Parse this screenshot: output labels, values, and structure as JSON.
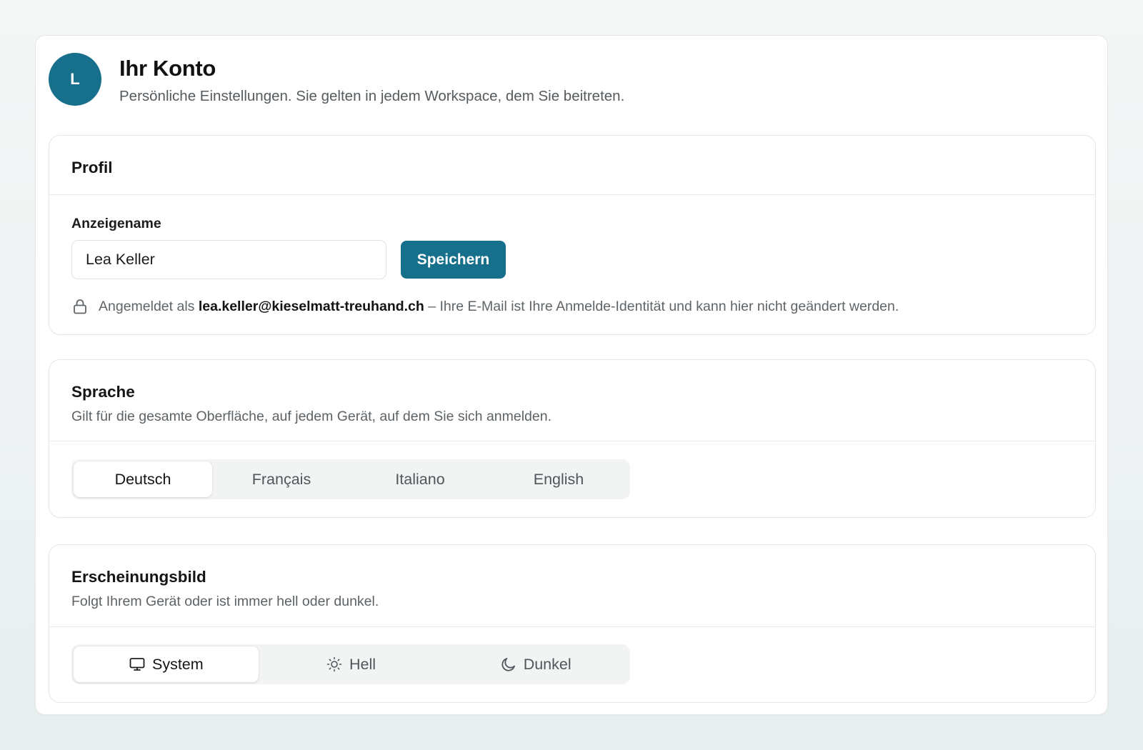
{
  "header": {
    "avatar_letter": "L",
    "title": "Ihr Konto",
    "subtitle": "Persönliche Einstellungen. Sie gelten in jedem Workspace, dem Sie beitreten."
  },
  "profile": {
    "title": "Profil",
    "display_name_label": "Anzeigename",
    "display_name_value": "Lea Keller",
    "save_label": "Speichern",
    "signed_in_prefix": "Angemeldet als",
    "email": "lea.keller@kieselmatt-treuhand.ch",
    "signed_in_suffix": "– Ihre E-Mail ist Ihre Anmelde-Identität und kann hier nicht geändert werden."
  },
  "language": {
    "title": "Sprache",
    "description": "Gilt für die gesamte Oberfläche, auf jedem Gerät, auf dem Sie sich anmelden.",
    "options": [
      "Deutsch",
      "Français",
      "Italiano",
      "English"
    ],
    "selected": "Deutsch"
  },
  "appearance": {
    "title": "Erscheinungsbild",
    "description": "Folgt Ihrem Gerät oder ist immer hell oder dunkel.",
    "options": [
      {
        "label": "System",
        "icon": "monitor-icon"
      },
      {
        "label": "Hell",
        "icon": "sun-icon"
      },
      {
        "label": "Dunkel",
        "icon": "moon-icon"
      }
    ],
    "selected": "System"
  },
  "colors": {
    "accent": "#16708c",
    "page_bg": "#eef2f2",
    "card_border": "#e3e7e8"
  }
}
